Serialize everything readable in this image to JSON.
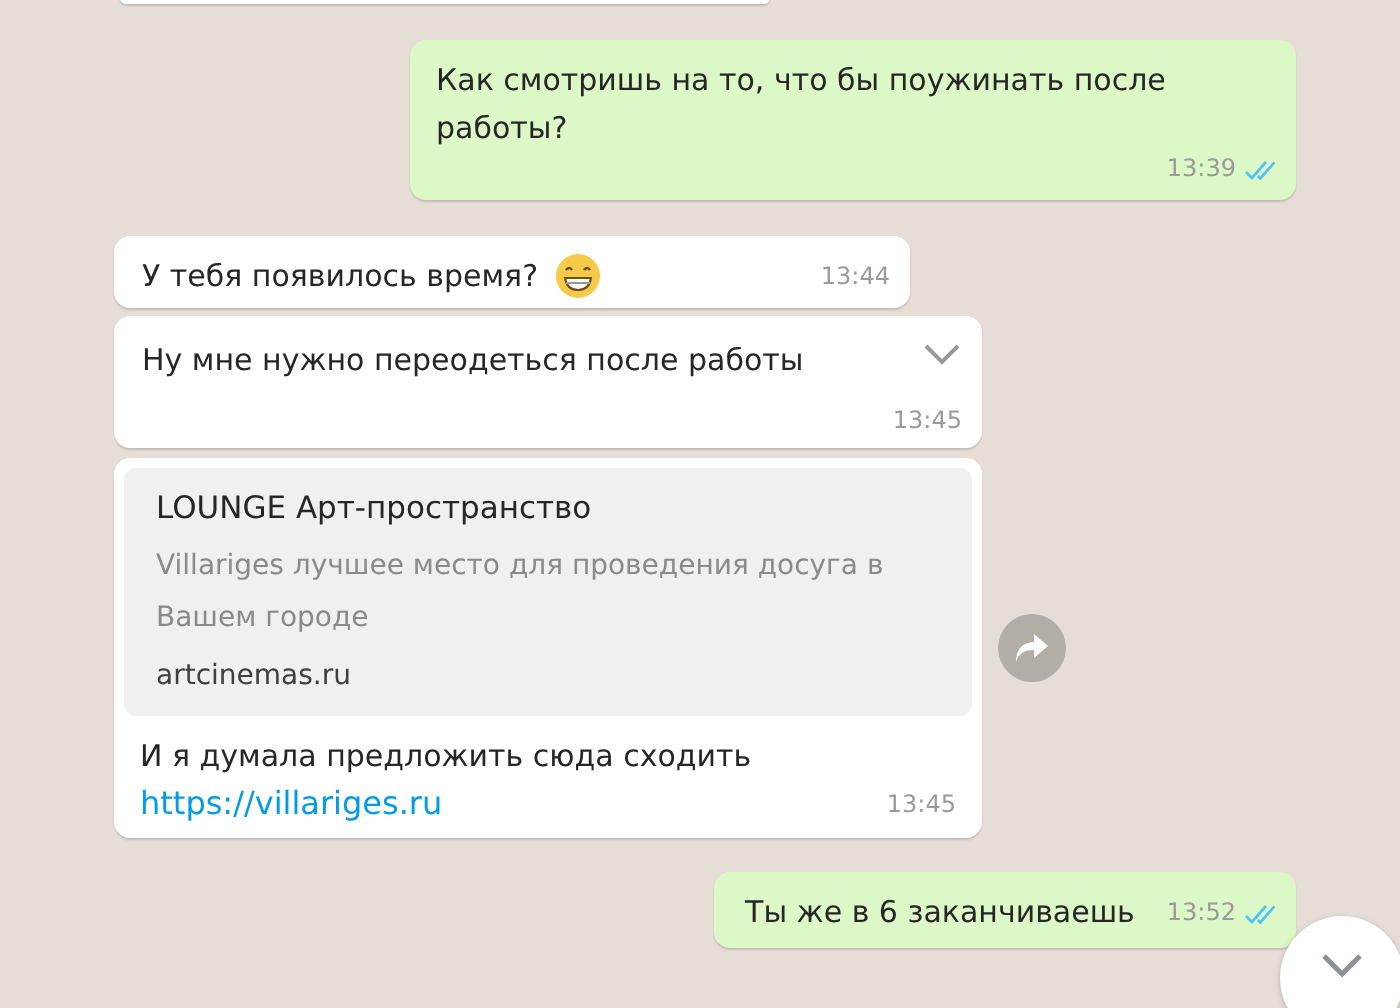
{
  "messages": [
    {
      "kind": "cut"
    },
    {
      "kind": "outgoing",
      "text": "Как смотришь на то, что бы поужинать после работы?",
      "time": "13:39",
      "read": true
    },
    {
      "kind": "incoming",
      "text": "У тебя появилось время?",
      "emoji": true,
      "time": "13:44"
    },
    {
      "kind": "incoming",
      "text": "Ну мне нужно переодеться после работы",
      "time": "13:45",
      "menu": true
    },
    {
      "kind": "incoming",
      "preview": {
        "title": "LOUNGE Арт-пространство",
        "description": "Villariges лучшее место для проведения досуга в Вашем городе",
        "domain": "artcinemas.ru"
      },
      "text": "И я думала предложить сюда сходить",
      "link": "https://villariges.ru",
      "time": "13:45",
      "forward": true
    },
    {
      "kind": "outgoing",
      "text": "Ты же в 6 заканчиваешь",
      "time": "13:52",
      "read": true
    }
  ],
  "scroll_down_button": true
}
